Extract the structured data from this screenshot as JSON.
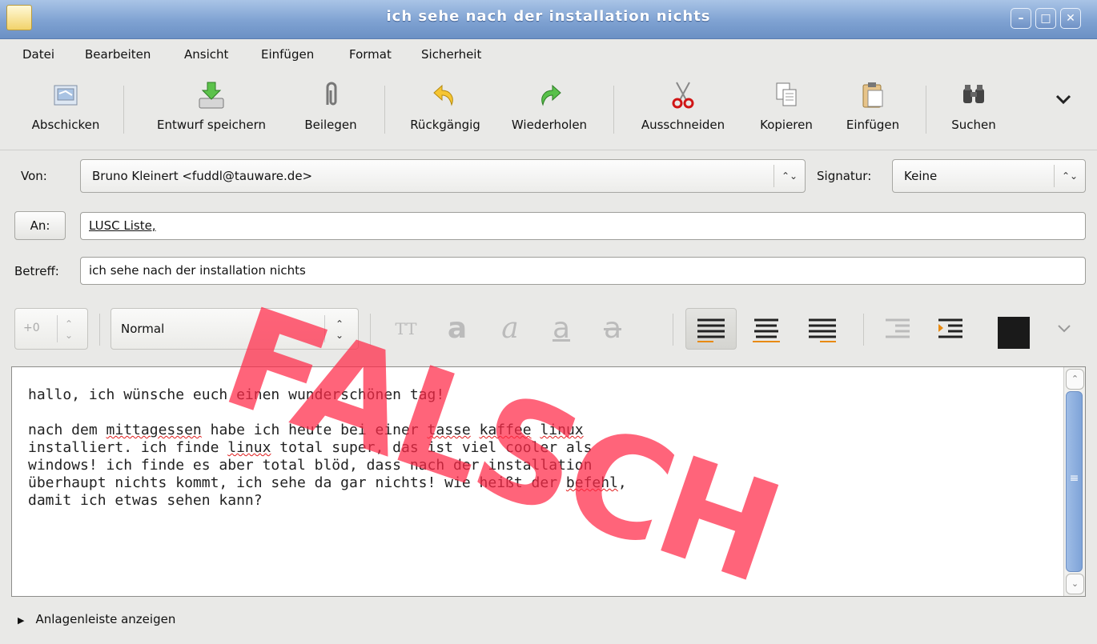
{
  "window": {
    "title": "ich sehe nach der installation nichts"
  },
  "menu": [
    "Datei",
    "Bearbeiten",
    "Ansicht",
    "Einfügen",
    "Format",
    "Sicherheit"
  ],
  "toolbar": {
    "send": "Abschicken",
    "save_draft": "Entwurf speichern",
    "attach": "Beilegen",
    "undo": "Rückgängig",
    "redo": "Wiederholen",
    "cut": "Ausschneiden",
    "copy": "Kopieren",
    "paste": "Einfügen",
    "search": "Suchen"
  },
  "header": {
    "from_label": "Von:",
    "from_value": "Bruno Kleinert <fuddl@tauware.de>",
    "signature_label": "Signatur:",
    "signature_value": "Keine",
    "to_button": "An:",
    "to_value": "LUSC Liste,",
    "subject_label": "Betreff:",
    "subject_value": "ich sehe nach der installation nichts"
  },
  "format": {
    "size": "+0",
    "paragraph_style": "Normal",
    "text_color": "#1a1a1a"
  },
  "body": {
    "line1": "hallo, ich wünsche euch einen wunderschönen tag!",
    "p2_a": "nach dem ",
    "p2_w1": "mittagessen",
    "p2_b": " habe ich heute bei einer ",
    "p2_w2": "tasse",
    "p2_c": " ",
    "p2_w3": "kaffee",
    "p2_d": " ",
    "p2_w4": "linux",
    "p2_e": "\ninstalliert. ich finde ",
    "p2_w5": "linux",
    "p2_f": " total super, das ist viel cooler als\nwindows! ich finde es aber total blöd, dass nach der installation\nüberhaupt nichts kommt, ich sehe da gar nichts! wie heißt der ",
    "p2_w6": "befehl",
    "p2_g": ",\ndamit ich etwas sehen kann?"
  },
  "attachments": "Anlagenleiste anzeigen",
  "watermark": "FALSCH"
}
